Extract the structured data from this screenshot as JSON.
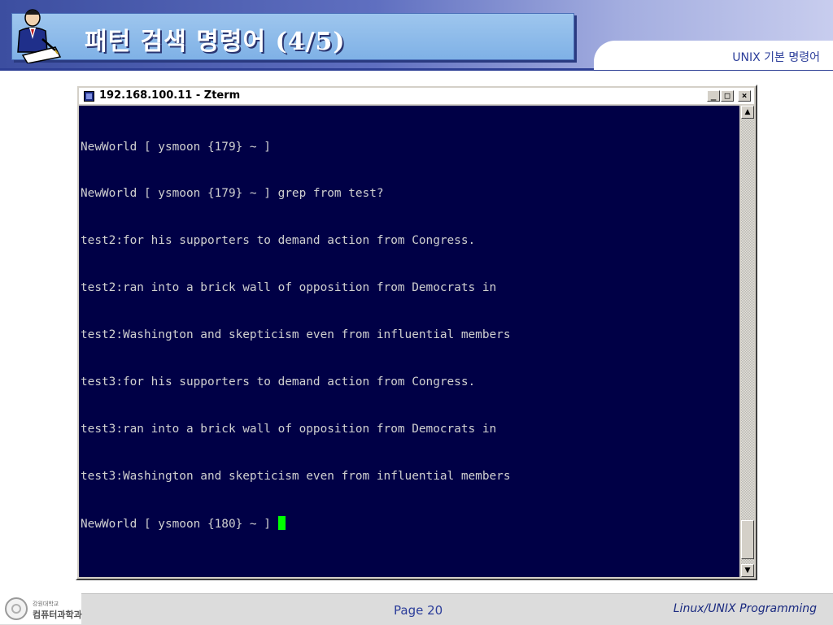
{
  "slide": {
    "title": "패턴 검색 명령어 (4/5)",
    "course_label": "UNIX 기본 명령어",
    "clipart_icon": "person-writing-icon"
  },
  "terminal": {
    "window_title": "192.168.100.11 - Zterm",
    "buttons": {
      "minimize": "_",
      "maximize": "□",
      "close": "×"
    },
    "background_color": "#000046",
    "text_color": "#d0d0d0",
    "cursor_color": "#00ff00",
    "lines": [
      "NewWorld [ ysmoon {179} ~ ]",
      "NewWorld [ ysmoon {179} ~ ] grep from test?",
      "test2:for his supporters to demand action from Congress.",
      "test2:ran into a brick wall of opposition from Democrats in",
      "test2:Washington and skepticism even from influential members",
      "test3:for his supporters to demand action from Congress.",
      "test3:ran into a brick wall of opposition from Democrats in",
      "test3:Washington and skepticism even from influential members",
      "NewWorld [ ysmoon {180} ~ ] "
    ]
  },
  "footer": {
    "logo_university": "강원대학교",
    "logo_department": "컴퓨터과학과",
    "page": "Page 20",
    "course": "Linux/UNIX Programming"
  }
}
